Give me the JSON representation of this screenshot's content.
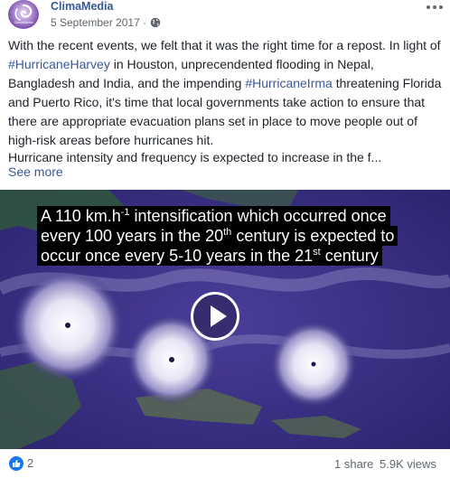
{
  "header": {
    "page_name": "ClimaMedia",
    "date": "5 September 2017",
    "separator": "·",
    "avatar_text": "ClimaMedia"
  },
  "post": {
    "para1": [
      {
        "text": "With the recent events, we felt that it was the right time for a repost. In light of ",
        "hashtag": false
      },
      {
        "text": "#HurricaneHarvey",
        "hashtag": true
      },
      {
        "text": " in Houston, unprecendented flooding in Nepal, Bangladesh and India, and the impending ",
        "hashtag": false
      },
      {
        "text": "#HurricaneIrma",
        "hashtag": true
      },
      {
        "text": " threatening Florida and Puerto Rico, it's time that local governments take action to ensure that there are appropriate evacuation plans set in place to move people out of high-risk areas before hurricanes hit.",
        "hashtag": false
      }
    ],
    "para2": "Hurricane intensity and frequency is expected to increase in the f...",
    "see_more": "See more"
  },
  "video": {
    "caption_line1_a": "A 110 km.h",
    "caption_line1_sup": "-1",
    "caption_line1_b": " intensification which occurred once",
    "caption_line2_a": "every 100 years in the 20",
    "caption_line2_sup": "th",
    "caption_line2_b": " century is expected to",
    "caption_line3_a": "occur once every 5-10 years in the 21",
    "caption_line3_sup": "st",
    "caption_line3_b": " century"
  },
  "footer": {
    "like_count": "2",
    "shares": "1 share",
    "views": "5.9K views"
  },
  "colors": {
    "link": "#385898",
    "like_blue": "#1877f2",
    "meta_grey": "#616770"
  }
}
